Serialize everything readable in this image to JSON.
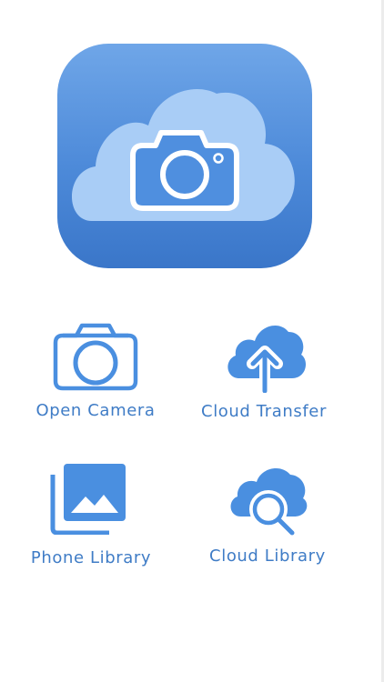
{
  "app": {
    "logo_icon": "cloud-camera-icon",
    "colors": {
      "accent": "#4a8fe0",
      "label_text": "#3f7cc6",
      "logo_gradient_top": "#6fa6e8",
      "logo_gradient_bottom": "#3a76c9",
      "logo_cloud": "#a9cdf6"
    }
  },
  "actions": [
    {
      "label": "Open Camera",
      "icon": "camera-icon"
    },
    {
      "label": "Cloud Transfer",
      "icon": "cloud-upload-icon"
    },
    {
      "label": "Phone Library",
      "icon": "photo-library-icon"
    },
    {
      "label": "Cloud Library",
      "icon": "cloud-search-icon"
    }
  ]
}
